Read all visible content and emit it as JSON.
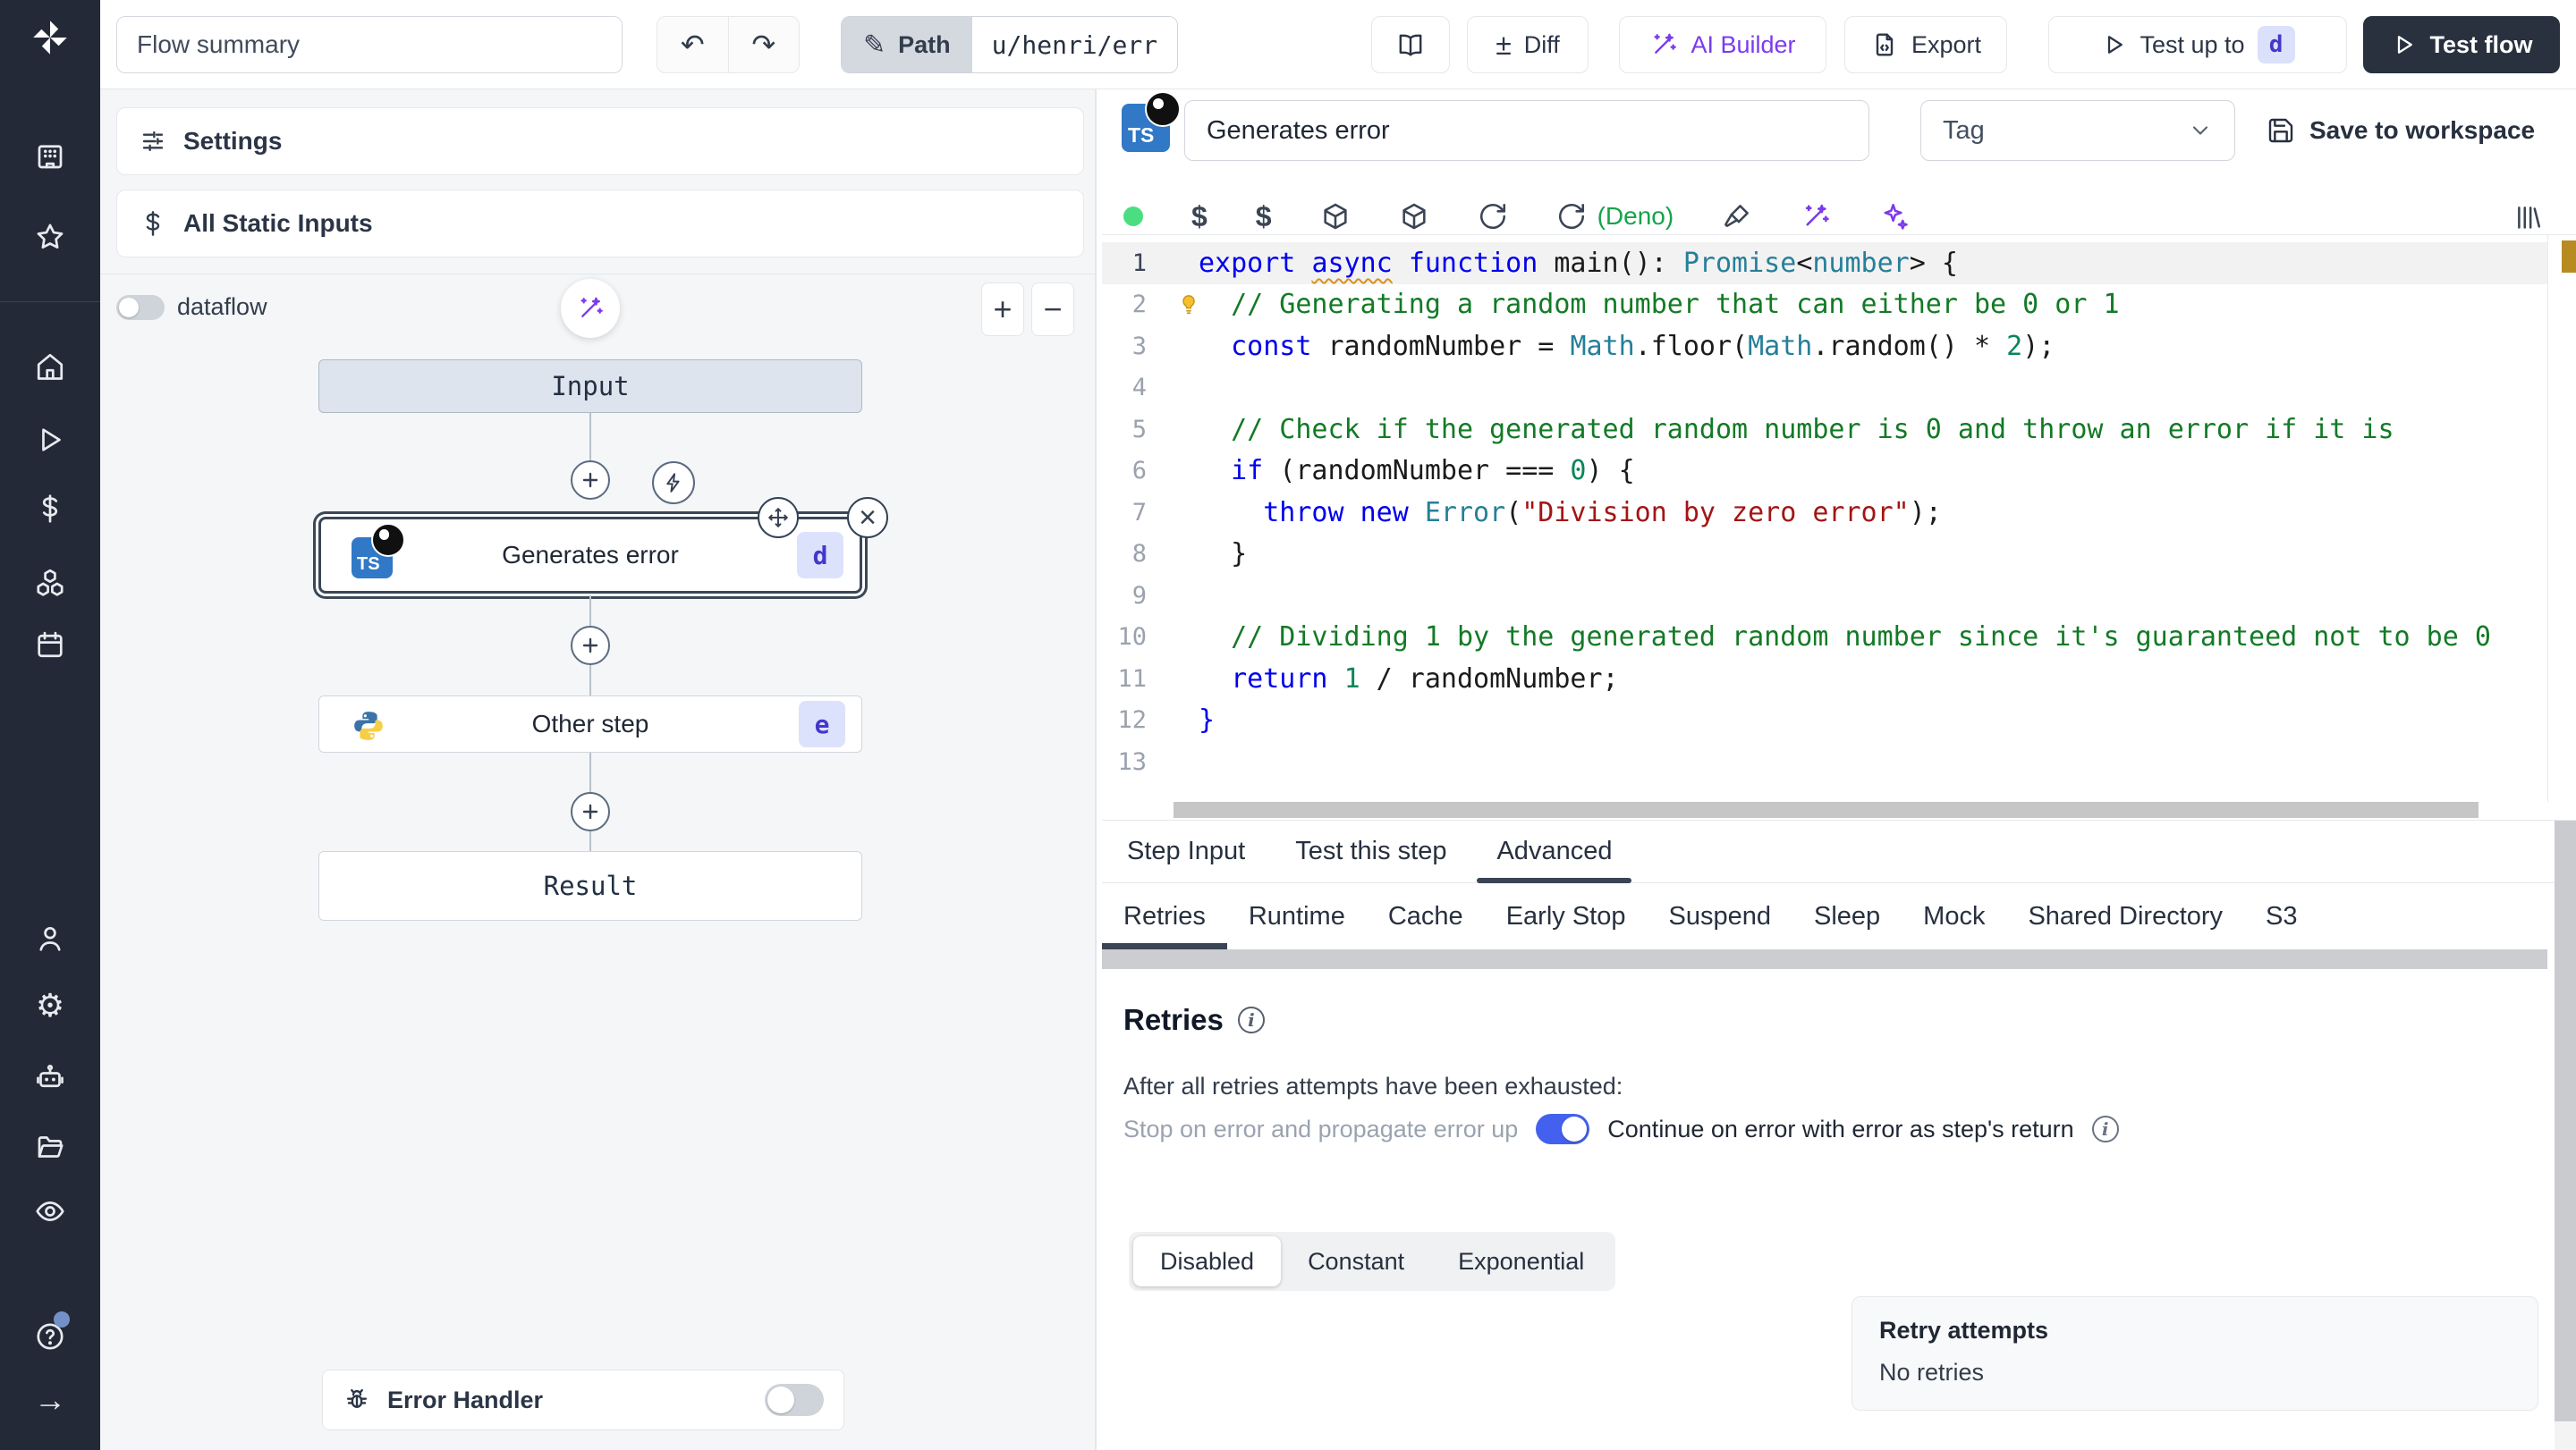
{
  "topbar": {
    "flow_summary": "Flow summary",
    "path_label": "Path",
    "path_value": "u/henri/err",
    "diff": "Diff",
    "ai_builder": "AI Builder",
    "export": "Export",
    "test_up_to": "Test up to",
    "test_up_to_badge": "d",
    "test_flow": "Test flow"
  },
  "icons": {
    "undo_icon": "↶",
    "redo_icon": "↷",
    "pencil_icon": "✎",
    "diff_icon": "±",
    "gear_icon": "⚙",
    "arrow_right_icon": "→",
    "close_icon": "×",
    "plus_icon": "+",
    "dollar_icon": "$",
    "refresh_icon": "↻",
    "question_icon": "?",
    "info_icon": "i"
  },
  "colors": {
    "accent_blue": "#4361ee",
    "ai_purple": "#7c3aed",
    "deno_green": "#16a34a",
    "status_green": "#4ade80",
    "badge_bg": "#dde2fc",
    "badge_text": "#4338ca",
    "dark_button": "#29303e",
    "ruler_marker": "#b78b22"
  },
  "flow_panel": {
    "settings": "Settings",
    "all_static_inputs": "All Static Inputs",
    "dataflow": "dataflow",
    "zoom_in": "+",
    "zoom_out": "−",
    "input_node": "Input",
    "step_node": {
      "title": "Generates error",
      "badge": "d",
      "lang": "TS"
    },
    "other_node": {
      "title": "Other step",
      "badge": "e"
    },
    "result_node": "Result",
    "error_handler": "Error Handler"
  },
  "step_panel": {
    "lang_badge": "TS",
    "name": "Generates error",
    "tag": "Tag",
    "save": "Save to workspace",
    "deno": "(Deno)"
  },
  "editor": {
    "lines": [
      {
        "n": "1",
        "active": true,
        "tokens": [
          [
            "export ",
            "kw"
          ],
          [
            "async",
            "kw sq"
          ],
          [
            " ",
            "pl"
          ],
          [
            "function ",
            "kw"
          ],
          [
            "main",
            "pl"
          ],
          [
            "(): ",
            "pl"
          ],
          [
            "Promise",
            "ty"
          ],
          [
            "<",
            "pl"
          ],
          [
            "number",
            "ty"
          ],
          [
            "> {",
            "pl"
          ]
        ]
      },
      {
        "n": "2",
        "bulb": true,
        "tokens": [
          [
            "  ",
            "pl"
          ],
          [
            "// Generating a random number that can either be 0 or 1",
            "cm"
          ]
        ]
      },
      {
        "n": "3",
        "tokens": [
          [
            "  ",
            "pl"
          ],
          [
            "const ",
            "kw"
          ],
          [
            "randomNumber",
            "pl"
          ],
          [
            " = ",
            "pl"
          ],
          [
            "Math",
            "ty"
          ],
          [
            ".floor(",
            "pl"
          ],
          [
            "Math",
            "ty"
          ],
          [
            ".random() ",
            "pl"
          ],
          [
            "* ",
            "pl"
          ],
          [
            "2",
            "nu"
          ],
          [
            ");",
            "pl"
          ]
        ]
      },
      {
        "n": "4",
        "tokens": []
      },
      {
        "n": "5",
        "tokens": [
          [
            "  ",
            "pl"
          ],
          [
            "// Check if the generated random number is 0 and throw an error if it is",
            "cm"
          ]
        ]
      },
      {
        "n": "6",
        "tokens": [
          [
            "  ",
            "pl"
          ],
          [
            "if ",
            "kw"
          ],
          [
            "(randomNumber === ",
            "pl"
          ],
          [
            "0",
            "nu"
          ],
          [
            ") {",
            "pl"
          ]
        ]
      },
      {
        "n": "7",
        "tokens": [
          [
            "    ",
            "pl"
          ],
          [
            "throw ",
            "kw"
          ],
          [
            "new ",
            "kw"
          ],
          [
            "Error",
            "ty"
          ],
          [
            "(",
            "pl"
          ],
          [
            "\"Division by zero error\"",
            "st"
          ],
          [
            ");",
            "pl"
          ]
        ]
      },
      {
        "n": "8",
        "tokens": [
          [
            "  }",
            "pl"
          ]
        ]
      },
      {
        "n": "9",
        "tokens": []
      },
      {
        "n": "10",
        "tokens": [
          [
            "  ",
            "pl"
          ],
          [
            "// Dividing 1 by the generated random number since it's guaranteed not to be 0",
            "cm"
          ]
        ]
      },
      {
        "n": "11",
        "tokens": [
          [
            "  ",
            "pl"
          ],
          [
            "return ",
            "kw"
          ],
          [
            "1",
            "nu"
          ],
          [
            " / randomNumber;",
            "pl"
          ]
        ]
      },
      {
        "n": "12",
        "tokens": [
          [
            "}",
            "kw"
          ]
        ]
      },
      {
        "n": "13",
        "tokens": []
      }
    ]
  },
  "tabs": {
    "items": [
      "Step Input",
      "Test this step",
      "Advanced"
    ],
    "active": 2
  },
  "subtabs": {
    "items": [
      "Retries",
      "Runtime",
      "Cache",
      "Early Stop",
      "Suspend",
      "Sleep",
      "Mock",
      "Shared Directory",
      "S3"
    ],
    "active": 0
  },
  "retries": {
    "title": "Retries",
    "exhausted": "After all retries attempts have been exhausted:",
    "stop_label": "Stop on error and propagate error up",
    "continue_label": "Continue on error with error as step's return",
    "strategies": [
      "Disabled",
      "Constant",
      "Exponential"
    ],
    "active_strategy": 0,
    "attempts_title": "Retry attempts",
    "attempts_value": "No retries"
  }
}
